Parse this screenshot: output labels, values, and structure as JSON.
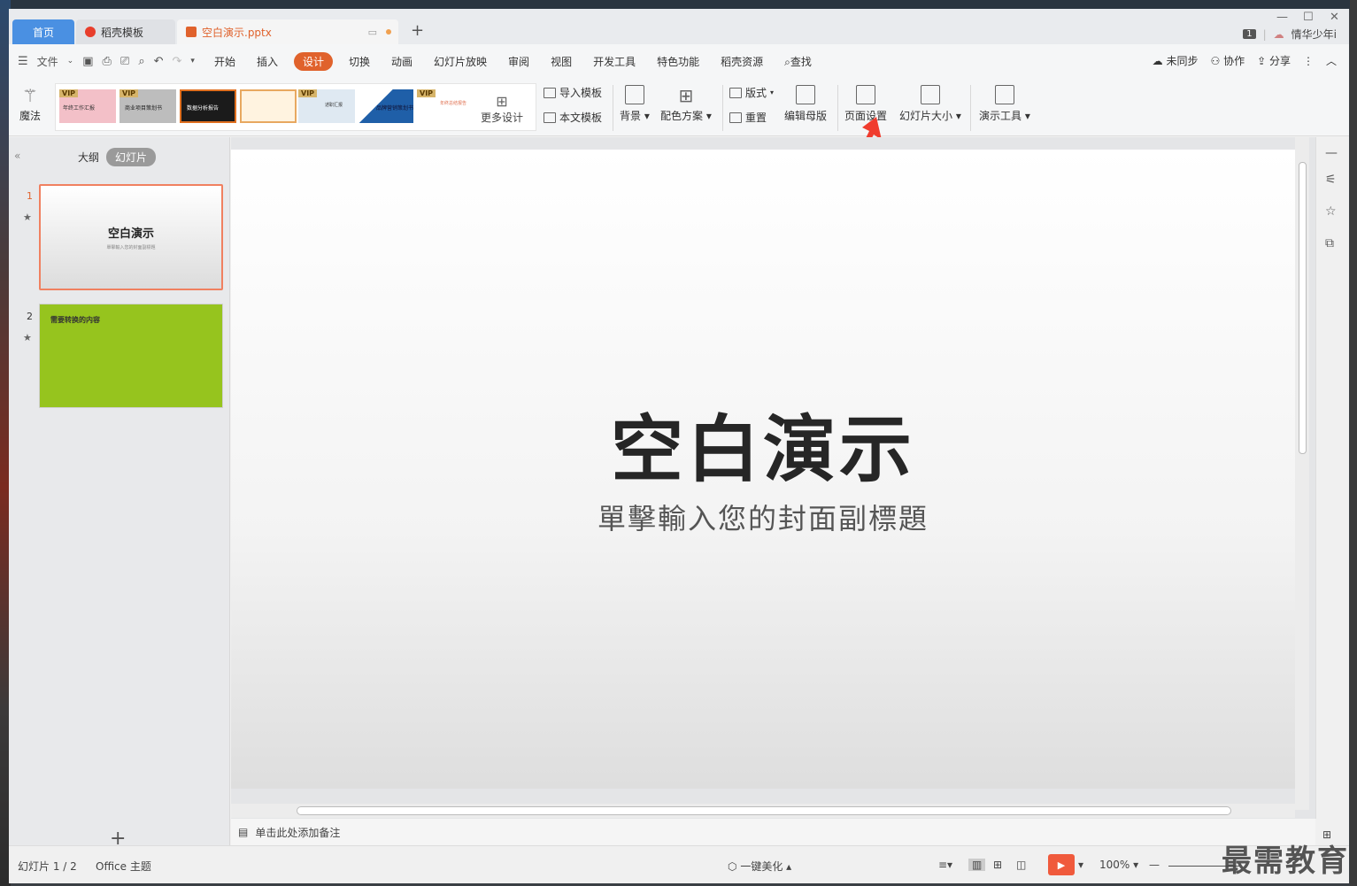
{
  "tabs": [
    {
      "label": "首页"
    },
    {
      "label": "稻壳模板"
    },
    {
      "label": "空白演示.pptx"
    }
  ],
  "user": {
    "badge": "1",
    "name": "情华少年i"
  },
  "menu": {
    "file": "文件",
    "items": [
      "开始",
      "插入",
      "设计",
      "切换",
      "动画",
      "幻灯片放映",
      "审阅",
      "视图",
      "开发工具",
      "特色功能",
      "稻壳资源"
    ],
    "search": "查找",
    "sync": "未同步",
    "collab": "协作",
    "share": "分享"
  },
  "ribbon": {
    "magic": "魔法",
    "vip": "VIP",
    "templates": [
      {
        "caption": "年终工作汇报",
        "color": "#f3c0c8"
      },
      {
        "caption": "商业项目策划书",
        "color": "#bdbdbd"
      },
      {
        "caption": "数据分析报告",
        "color": "#1b1b1b"
      },
      {
        "caption": "",
        "color": "#fff3e0"
      },
      {
        "caption": "述职汇报",
        "color": "#dfe9f2"
      },
      {
        "caption": "品牌营销策划书",
        "color": "#1f5fa8"
      },
      {
        "caption": "年终总结报告",
        "color": "#ffffff"
      }
    ],
    "more_design": "更多设计",
    "import_template": "导入模板",
    "this_template": "本文模板",
    "background": "背景",
    "color_scheme": "配色方案",
    "layout": "版式",
    "reset": "重置",
    "edit_master": "编辑母版",
    "page_setup": "页面设置",
    "slide_size": "幻灯片大小",
    "presenter_tools": "演示工具"
  },
  "panel": {
    "outline": "大纲",
    "slides": "幻灯片",
    "slide1": {
      "num": "1",
      "title": "空白演示",
      "subtitle": "單擊輸入您的封面副標題"
    },
    "slide2": {
      "num": "2",
      "text": "需要转换的内容"
    }
  },
  "slide": {
    "title": "空白演示",
    "subtitle": "單擊輸入您的封面副標題"
  },
  "notes": {
    "placeholder": "单击此处添加备注"
  },
  "status": {
    "slide_count": "幻灯片 1 / 2",
    "theme": "Office 主题",
    "beautify": "一键美化",
    "zoom": "100%"
  },
  "watermark": "最需教育"
}
